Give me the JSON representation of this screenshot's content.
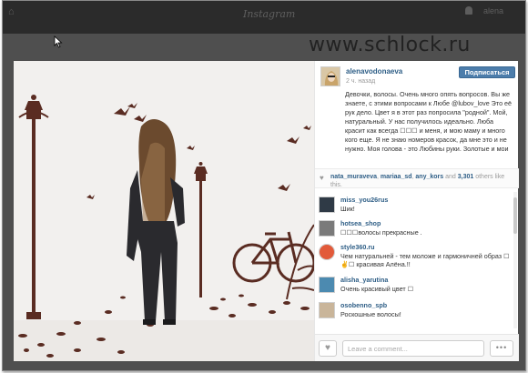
{
  "topbar": {
    "brand": "Instagram",
    "user": "alena"
  },
  "watermark": "www.schlock.ru",
  "post": {
    "author": "alenavodonaeva",
    "time": "2 ч. назад",
    "follow_label": "Подписаться",
    "caption": "Девочки, волосы. Очень много опять вопросов. Вы же знаете, с этими вопросами к Любе @lubov_love Это её рук дело. Цвет я в этот раз попросила \"родной\". Мой, натуральный. У нас получилось идеально. Люба красит как всегда ☐☐☐ и меня, и мою маму и много кого еще. Я не знаю номеров красок, да мне это и не нужно. Моя голова - это Любины руки. Золотые и мои",
    "likes": {
      "users": [
        "nata_muraveva",
        "mariaa_sd",
        "any_kors"
      ],
      "count": "3,301",
      "suffix": "others like this."
    }
  },
  "comments": [
    {
      "user": "miss_you26rus",
      "text": "Шик!"
    },
    {
      "user": "hotsea_shop",
      "text": "☐☐☐волосы прекрасные ."
    },
    {
      "user": "style360.ru",
      "text": "Чем натуральней - тем моложе и гармоничней образ ☐✌☐ красивая Алёна.!!"
    },
    {
      "user": "alisha_yarutina",
      "text": "Очень красивый цвет ☐"
    },
    {
      "user": "osobenno_spb",
      "text": "Роскошные волосы!"
    }
  ],
  "comment_box": {
    "placeholder": "Leave a comment...",
    "more_label": "•••"
  },
  "colors": {
    "link": "#2e5e86",
    "follow": "#4c7dab",
    "wall_art": "#5a2c22"
  }
}
